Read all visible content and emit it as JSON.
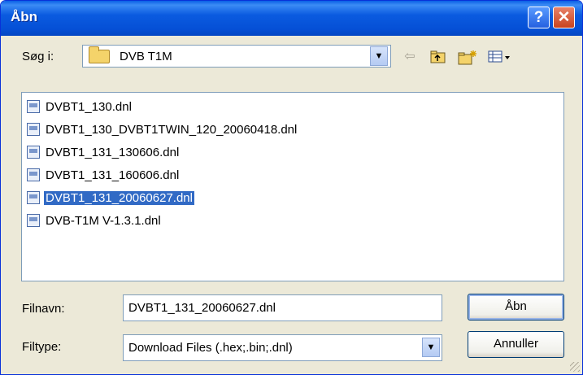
{
  "window": {
    "title": "Åbn"
  },
  "lookin": {
    "label": "Søg i:",
    "value": "DVB T1M"
  },
  "files": [
    {
      "name": "DVBT1_130.dnl",
      "selected": false
    },
    {
      "name": "DVBT1_130_DVBT1TWIN_120_20060418.dnl",
      "selected": false
    },
    {
      "name": "DVBT1_131_130606.dnl",
      "selected": false
    },
    {
      "name": "DVBT1_131_160606.dnl",
      "selected": false
    },
    {
      "name": "DVBT1_131_20060627.dnl",
      "selected": true
    },
    {
      "name": "DVB-T1M V-1.3.1.dnl",
      "selected": false
    }
  ],
  "filename": {
    "label": "Filnavn:",
    "value": "DVBT1_131_20060627.dnl"
  },
  "filetype": {
    "label": "Filtype:",
    "value": "Download Files (.hex;.bin;.dnl)"
  },
  "buttons": {
    "open": "Åbn",
    "cancel": "Annuller"
  },
  "colors": {
    "selection": "#316AC5",
    "titlebar": "#0A5FE6"
  },
  "icons": [
    "help-icon",
    "close-icon",
    "back-arrow-icon",
    "up-folder-icon",
    "new-folder-icon",
    "view-menu-icon"
  ]
}
